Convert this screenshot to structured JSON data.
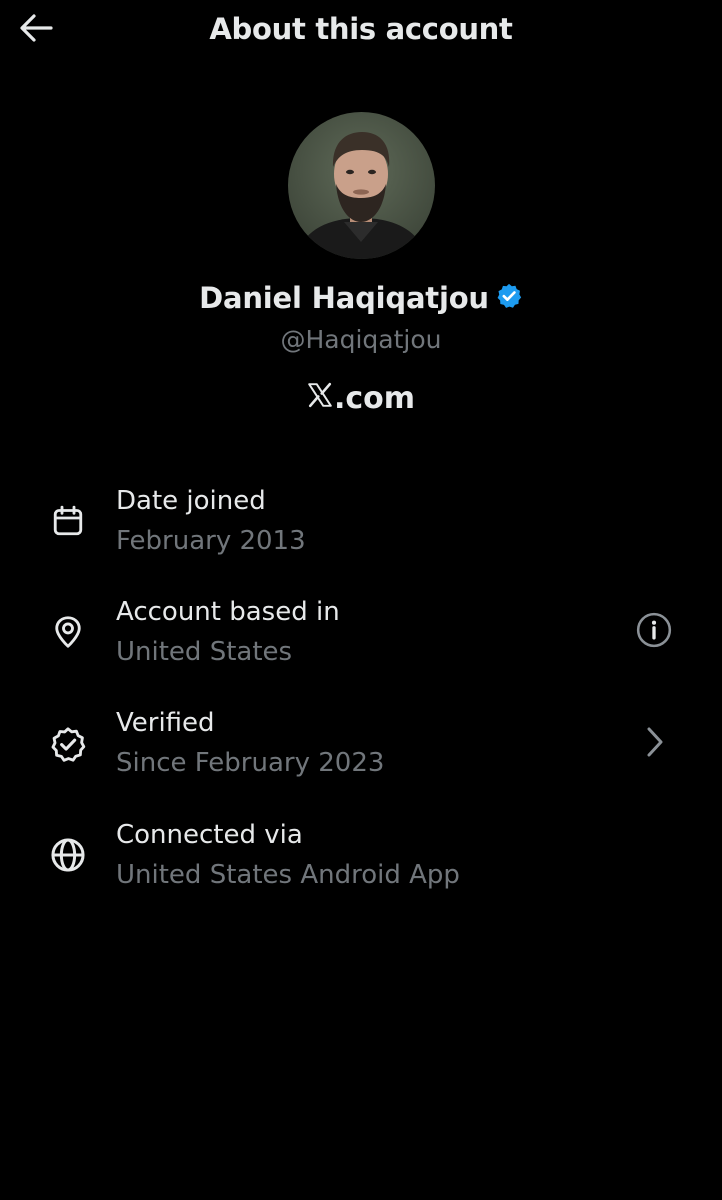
{
  "header": {
    "title": "About this account",
    "back_icon": "arrow-left-icon"
  },
  "profile": {
    "display_name": "Daniel Haqiqatjou",
    "verified_badge_icon": "verified-badge-icon",
    "verified_badge_color": "#1d9bf0",
    "handle": "@Haqiqatjou",
    "site_text": ".com",
    "site_logo_icon": "x-logo-icon"
  },
  "details": [
    {
      "icon": "calendar-icon",
      "label": "Date joined",
      "value": "February 2013"
    },
    {
      "icon": "location-pin-icon",
      "label": "Account based in",
      "value": "United States",
      "trailing_icon": "info-circle-icon"
    },
    {
      "icon": "verified-outline-icon",
      "label": "Verified",
      "value": "Since February 2023",
      "trailing_icon": "chevron-right-icon"
    },
    {
      "icon": "globe-icon",
      "label": "Connected via",
      "value": "United States Android App"
    }
  ],
  "colors": {
    "background": "#000000",
    "primary_text": "#e7e9ea",
    "secondary_text": "#71767b",
    "accent": "#1d9bf0"
  }
}
